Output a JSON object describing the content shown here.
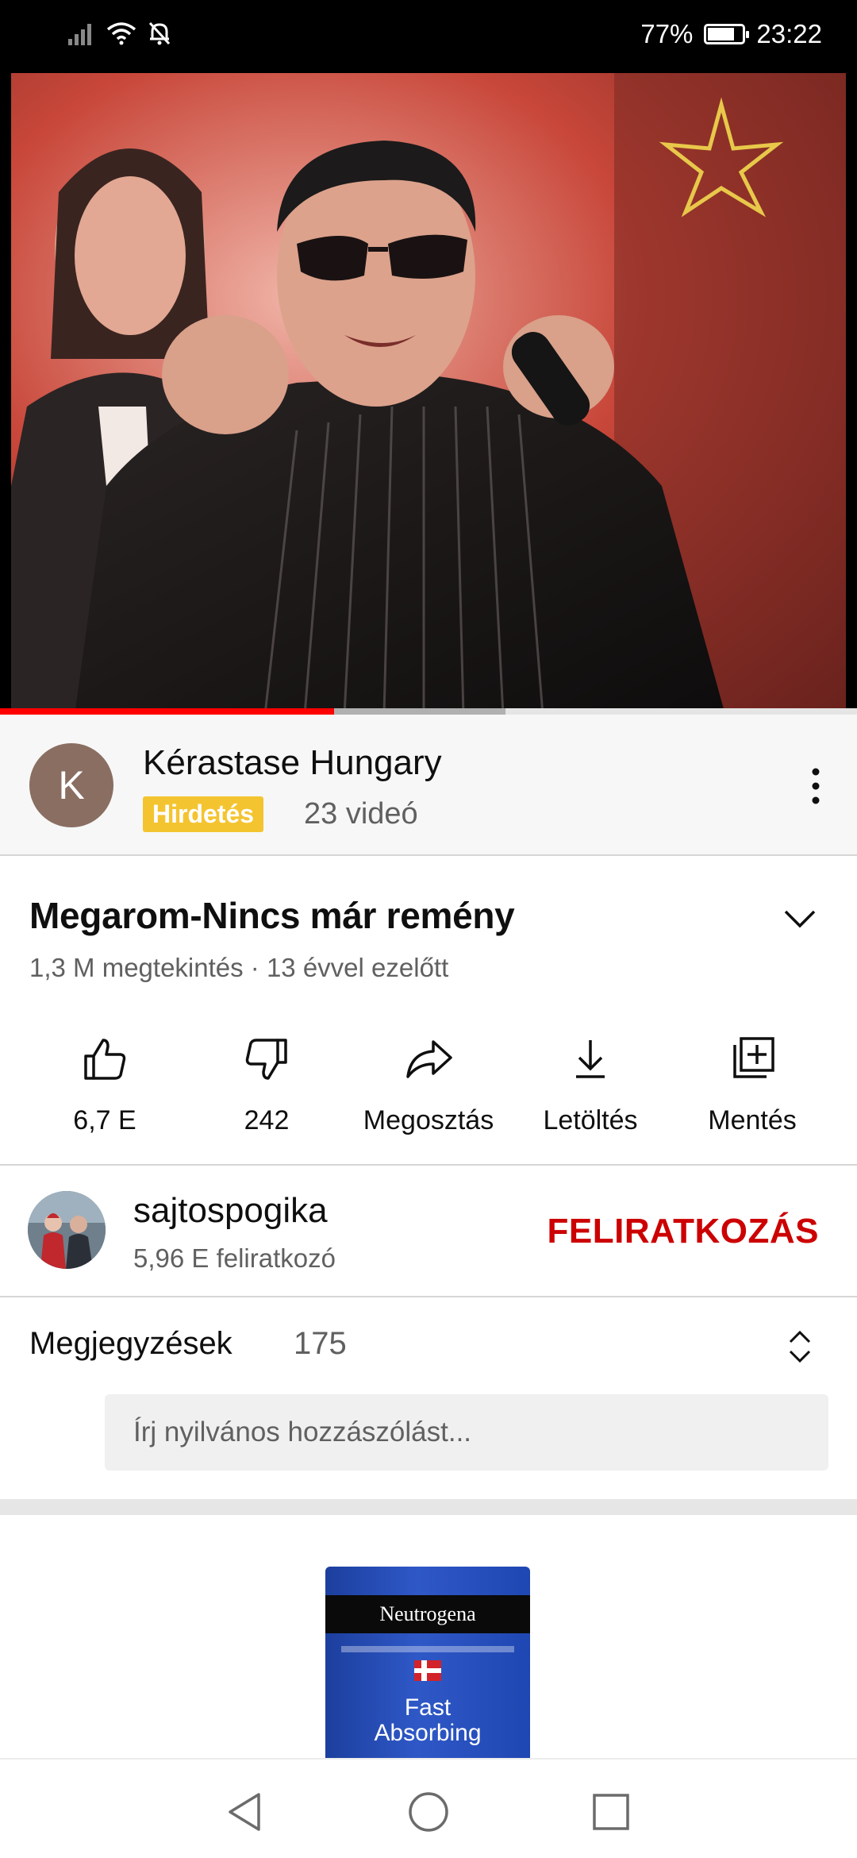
{
  "status_bar": {
    "battery": "77%",
    "battery_level": 0.77,
    "time": "23:22"
  },
  "player": {
    "played_fraction": 0.39,
    "buffered_fraction": 0.59
  },
  "ad": {
    "avatar_letter": "K",
    "title": "Kérastase Hungary",
    "badge": "Hirdetés",
    "video_count": "23 videó"
  },
  "video": {
    "title": "Megarom-Nincs már remény",
    "meta": "1,3 M megtekintés · 13 évvel ezelőtt"
  },
  "actions": [
    {
      "label": "6,7 E",
      "icon": "thumbs-up-icon"
    },
    {
      "label": "242",
      "icon": "thumbs-down-icon"
    },
    {
      "label": "Megosztás",
      "icon": "share-icon"
    },
    {
      "label": "Letöltés",
      "icon": "download-icon"
    },
    {
      "label": "Mentés",
      "icon": "save-playlist-icon"
    }
  ],
  "channel": {
    "name": "sajtospogika",
    "subscribers": "5,96 E feliratkozó",
    "subscribe_label": "FELIRATKOZÁS"
  },
  "comments": {
    "title": "Megjegyzések",
    "count": "175",
    "placeholder": "Írj nyilvános hozzászólást..."
  },
  "product_ad": {
    "brand": "Neutrogena",
    "line1": "Fast",
    "line2": "Absorbing"
  },
  "colors": {
    "accent_red": "#cc0000",
    "progress_red": "#ff0000",
    "badge_yellow": "#f4c430",
    "secondary_text": "#606060"
  }
}
